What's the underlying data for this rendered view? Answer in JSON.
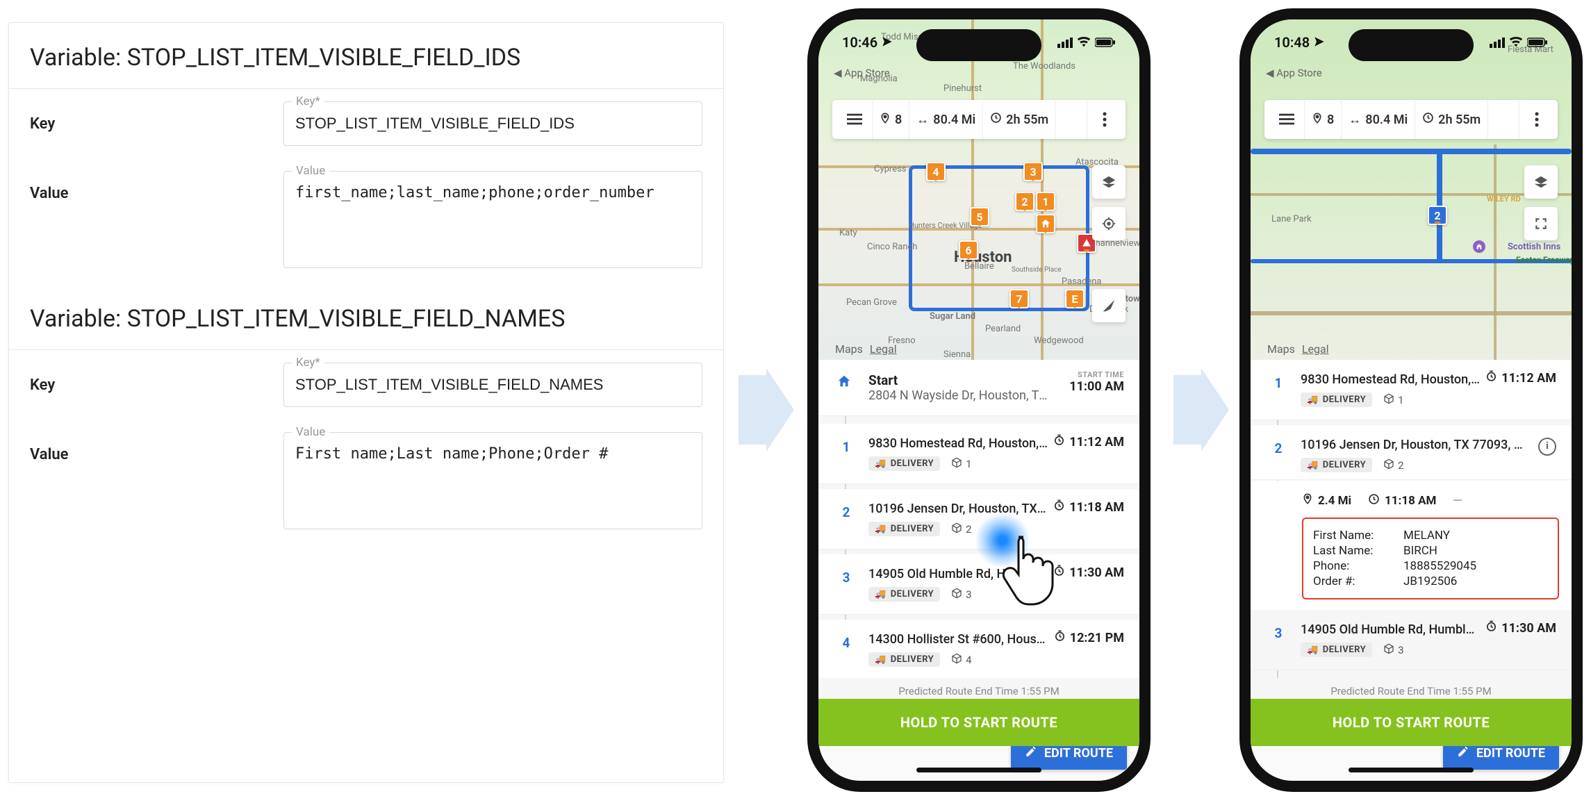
{
  "vars": {
    "block1": {
      "title": "Variable: STOP_LIST_ITEM_VISIBLE_FIELD_IDS",
      "key_legend": "Key*",
      "key_value": "STOP_LIST_ITEM_VISIBLE_FIELD_IDS",
      "value_legend": "Value",
      "value_value": "first_name;last_name;phone;order_number",
      "key_label": "Key",
      "value_label": "Value"
    },
    "block2": {
      "title": "Variable: STOP_LIST_ITEM_VISIBLE_FIELD_NAMES",
      "key_legend": "Key*",
      "key_value": "STOP_LIST_ITEM_VISIBLE_FIELD_NAMES",
      "value_legend": "Value",
      "value_value": "First name;Last name;Phone;Order #",
      "key_label": "Key",
      "value_label": "Value"
    }
  },
  "phone1": {
    "status": {
      "time": "10:46",
      "app_back": "App Store"
    },
    "toolbar": {
      "stops": "8",
      "distance": "80.4 Mi",
      "duration": "2h 55m"
    },
    "edit_btn": "EDIT ROUTE",
    "map": {
      "credit": "Maps",
      "legal": "Legal",
      "city": "Houston"
    },
    "map_labels": [
      "Todd Mission",
      "The Woodlands",
      "Magnolia",
      "Pinehurst",
      "Cypress",
      "Atascocita",
      "Katy",
      "Hunters Creek Village",
      "Cinco Ranch",
      "Bellaire",
      "Southside Place",
      "Pasadena",
      "Channelview",
      "Pecan Grove",
      "Sugar Land",
      "Pearland",
      "Deer Park",
      "Fresno",
      "Sienna",
      "Wedgewood",
      "Baytown"
    ],
    "stops": {
      "start": {
        "label": "Start",
        "addr": "2804 N Wayside Dr, Houston, TX 77…",
        "start_label": "START TIME",
        "time": "11:00 AM"
      },
      "s1": {
        "addr": "9830 Homestead Rd, Houston,…",
        "time": "11:12 AM",
        "tag": "DELIVERY",
        "boxes": "1"
      },
      "s2": {
        "addr": "10196 Jensen Dr, Houston, TX…",
        "time": "11:18 AM",
        "tag": "DELIVERY",
        "boxes": "2"
      },
      "s3": {
        "addr": "14905 Old Humble Rd, H…",
        "time": "11:30 AM",
        "tag": "DELIVERY",
        "boxes": "3"
      },
      "s4": {
        "addr": "14300 Hollister St #600, Houst…",
        "time": "12:21 PM",
        "tag": "DELIVERY",
        "boxes": "4"
      }
    },
    "predicted": "Predicted Route End Time 1:55 PM",
    "hold": "HOLD TO START ROUTE"
  },
  "phone2": {
    "status": {
      "time": "10:48",
      "app_back": "App Store"
    },
    "toolbar": {
      "stops": "8",
      "distance": "80.4 Mi",
      "duration": "2h 55m"
    },
    "edit_btn": "EDIT ROUTE",
    "map": {
      "credit": "Maps",
      "legal": "Legal"
    },
    "map_labels": [
      "Fiesta Mart",
      "Lane Park",
      "WILEY RD",
      "Scottish Inns",
      "Eastex Freeway - North"
    ],
    "stops": {
      "s1": {
        "addr": "9830 Homestead Rd, Houston,…",
        "time": "11:12 AM",
        "tag": "DELIVERY",
        "boxes": "1"
      },
      "s2": {
        "addr": "10196 Jensen Dr, Houston, TX 77093, USA",
        "tag": "DELIVERY",
        "boxes": "2",
        "metric_dist": "2.4 Mi",
        "metric_time": "11:18 AM",
        "fields": {
          "first_name_k": "First Name:",
          "first_name_v": "MELANY",
          "last_name_k": "Last Name:",
          "last_name_v": "BIRCH",
          "phone_k": "Phone:",
          "phone_v": "18885529045",
          "order_k": "Order #:",
          "order_v": "JB192506"
        }
      },
      "s3": {
        "addr": "14905 Old Humble Rd, Humble…",
        "time": "11:30 AM",
        "tag": "DELIVERY",
        "boxes": "3"
      }
    },
    "predicted": "Predicted Route End Time 1:55 PM",
    "hold": "HOLD TO START ROUTE"
  },
  "stop_numbers": {
    "one": "1",
    "two": "2",
    "three": "3",
    "four": "4"
  }
}
